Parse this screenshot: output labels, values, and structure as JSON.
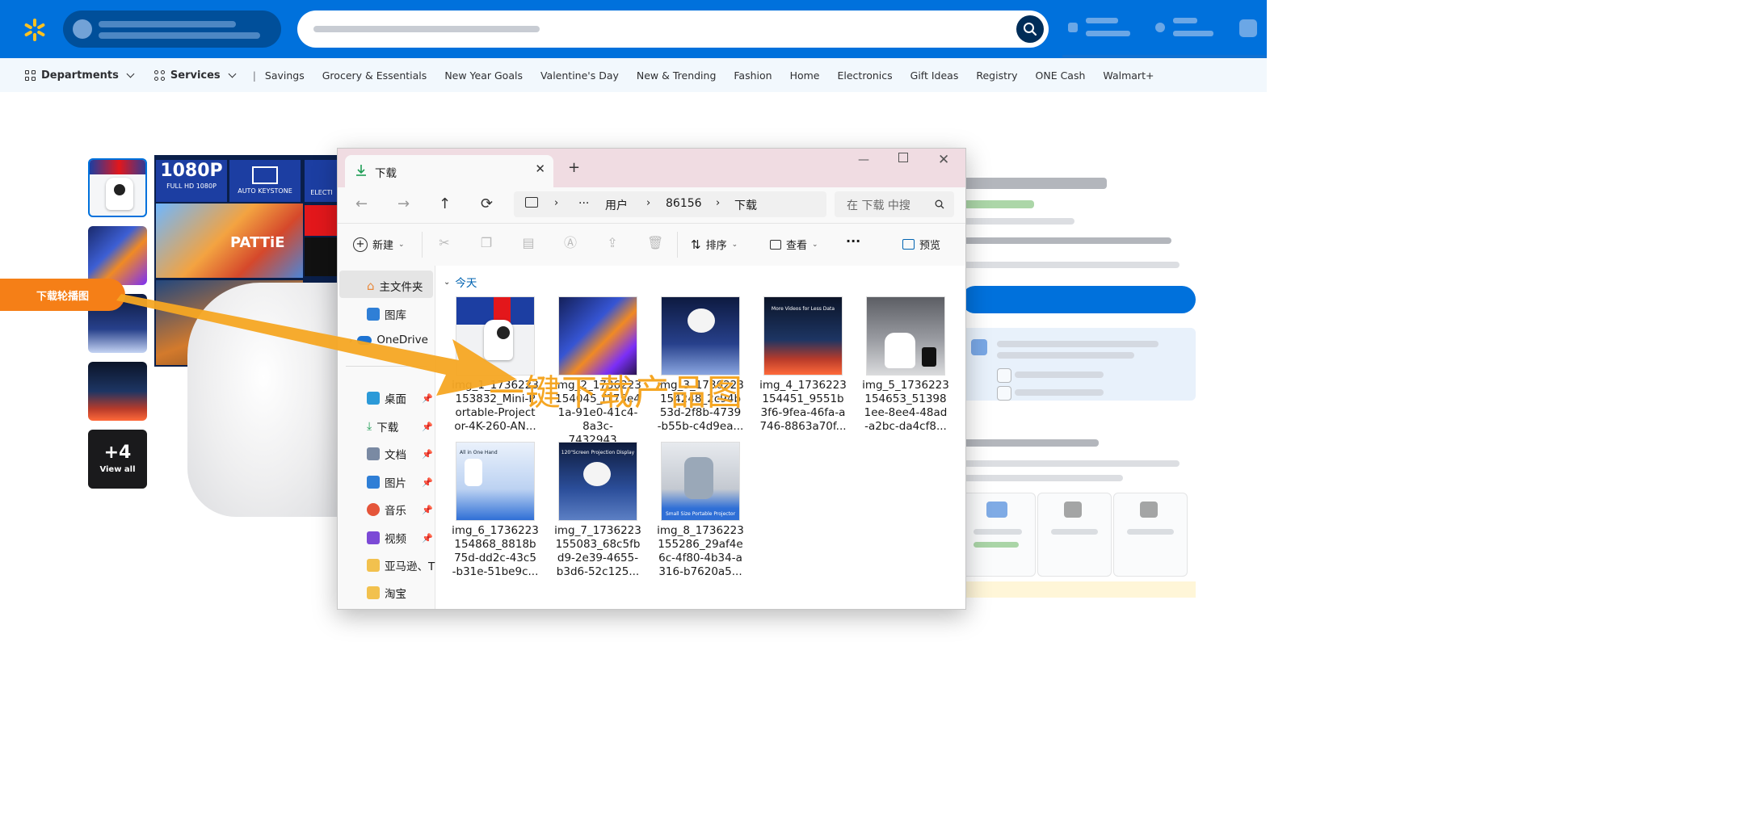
{
  "walmart": {
    "nav": {
      "departments": "Departments",
      "services": "Services",
      "separator": "|",
      "links": [
        "Savings",
        "Grocery & Essentials",
        "New Year Goals",
        "Valentine's Day",
        "New & Trending",
        "Fashion",
        "Home",
        "Electronics",
        "Gift Ideas",
        "Registry",
        "ONE Cash",
        "Walmart+"
      ]
    },
    "colors": {
      "brand_blue": "#0071dc",
      "spark_yellow": "#ffc220",
      "nav_bg": "#f2f8fd"
    },
    "product": {
      "collage_badge": "1080P",
      "collage_badge_sub": "FULL HD 1080P",
      "collage_badge2": "AUTO KEYSTONE",
      "collage_badge3": "ELECTI",
      "collage_art_text": "PATTiE",
      "view_all_count": "+4",
      "view_all_label": "View all"
    }
  },
  "annotation": {
    "pill_label": "下载轮播图",
    "overlay_text": "一键下载产品图",
    "arrow_color": "#f5a623"
  },
  "explorer": {
    "tab_title": "下载",
    "close_glyph": "✕",
    "add_glyph": "+",
    "address": {
      "crumbs": [
        "用户",
        "86156",
        "下载"
      ],
      "more": "···"
    },
    "search_placeholder": "在 下载 中搜",
    "toolbar": {
      "new": "新建",
      "sort": "排序",
      "view": "查看",
      "more": "···",
      "preview": "预览"
    },
    "sidebar": {
      "home": "主文件夹",
      "gallery": "图库",
      "onedrive": "OneDrive",
      "pinned": [
        "桌面",
        "下载",
        "文档",
        "图片",
        "音乐",
        "视频"
      ],
      "folders": [
        "亚马逊、T",
        "淘宝"
      ]
    },
    "group_label": "今天",
    "files": [
      {
        "name": "img_1_1736223153832_Mini-Portable-Projector-4K-260-AN...",
        "lines": [
          "img_1_1736223",
          "153832_Mini-P",
          "ortable-Project",
          "or-4K-260-AN..."
        ]
      },
      {
        "name": "img_2_1736223154045_f175e4...",
        "lines": [
          "img_2_1736223",
          "154045_f175e4",
          "1a-91e0-41c4-",
          "8a3c-7432943..."
        ]
      },
      {
        "name": "img_3_1736223154248_2c94b...",
        "lines": [
          "img_3_1736223",
          "154248_2c94b",
          "53d-2f8b-4739",
          "-b55b-c4d9ea..."
        ]
      },
      {
        "name": "img_4_1736223154451_9551b...",
        "lines": [
          "img_4_1736223",
          "154451_9551b",
          "3f6-9fea-46fa-a",
          "746-8863a70f..."
        ]
      },
      {
        "name": "img_5_1736223154653_51398...",
        "lines": [
          "img_5_1736223",
          "154653_51398",
          "1ee-8ee4-48ad",
          "-a2bc-da4cf8..."
        ]
      },
      {
        "name": "img_6_1736223154868_8818b...",
        "lines": [
          "img_6_1736223",
          "154868_8818b",
          "75d-dd2c-43c5",
          "-b31e-51be9c..."
        ]
      },
      {
        "name": "img_7_1736223155083_68c5fb...",
        "lines": [
          "img_7_1736223",
          "155083_68c5fb",
          "d9-2e39-4655-",
          "b3d6-52c125..."
        ]
      },
      {
        "name": "img_8_1736223155286_29af4e...",
        "lines": [
          "img_8_1736223",
          "155286_29af4e",
          "6c-4f80-4b34-a",
          "316-b7620a5..."
        ]
      }
    ],
    "thumb_captions": {
      "img4": "More Videos for Less Data",
      "img6": "All in One Hand",
      "img7": "120\"Screen Projection Display",
      "img8": "Small Size Portable Projector"
    }
  }
}
